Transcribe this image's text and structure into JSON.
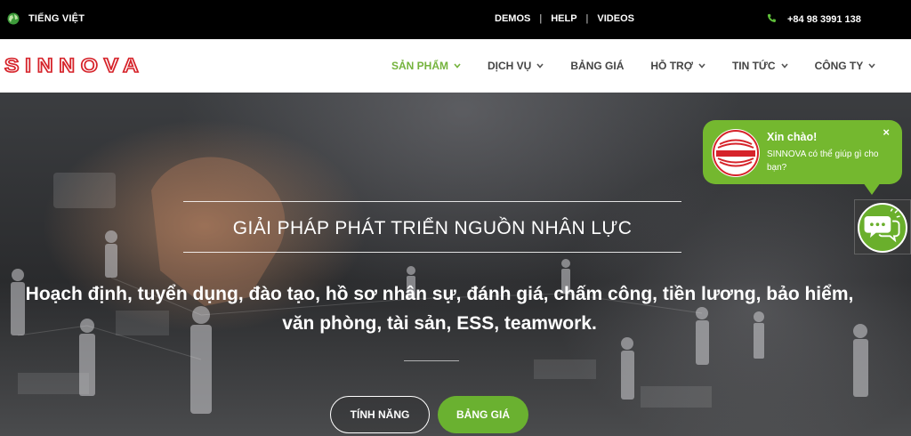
{
  "topbar": {
    "language": "TIẾNG VIỆT",
    "links": [
      "DEMOS",
      "HELP",
      "VIDEOS"
    ],
    "separator": "|",
    "phone": "+84 98 3991 138"
  },
  "brand": {
    "logo_text": "SINNOVA"
  },
  "nav": {
    "items": [
      {
        "label": "SẢN PHẨM",
        "has_dropdown": true,
        "active": true
      },
      {
        "label": "DỊCH VỤ",
        "has_dropdown": true,
        "active": false
      },
      {
        "label": "BẢNG GIÁ",
        "has_dropdown": false,
        "active": false
      },
      {
        "label": "HỖ TRỢ",
        "has_dropdown": true,
        "active": false
      },
      {
        "label": "TIN TỨC",
        "has_dropdown": true,
        "active": false
      },
      {
        "label": "CÔNG TY",
        "has_dropdown": true,
        "active": false
      }
    ]
  },
  "hero": {
    "title": "GIẢI PHÁP PHÁT TRIỂN NGUỒN NHÂN LỰC",
    "subtitle": "Hoạch định, tuyển dụng, đào tạo, hồ sơ nhân sự, đánh giá, chấm công, tiền lương, bảo hiểm, văn phòng, tài sản, ESS, teamwork.",
    "buttons": {
      "features": "TÍNH NĂNG",
      "pricing": "BẢNG GIÁ"
    }
  },
  "chat": {
    "greeting": "Xin chào!",
    "message": "SINNOVA có thể giúp gì cho bạn?",
    "close": "×"
  },
  "colors": {
    "accent_green": "#74b33c",
    "brand_red": "#d6232a",
    "topbar_bg": "#000000",
    "nav_bg": "#ffffff"
  },
  "icons": [
    "globe-icon",
    "phone-icon",
    "chevron-down-icon",
    "close-icon",
    "chat-bubbles-icon"
  ]
}
